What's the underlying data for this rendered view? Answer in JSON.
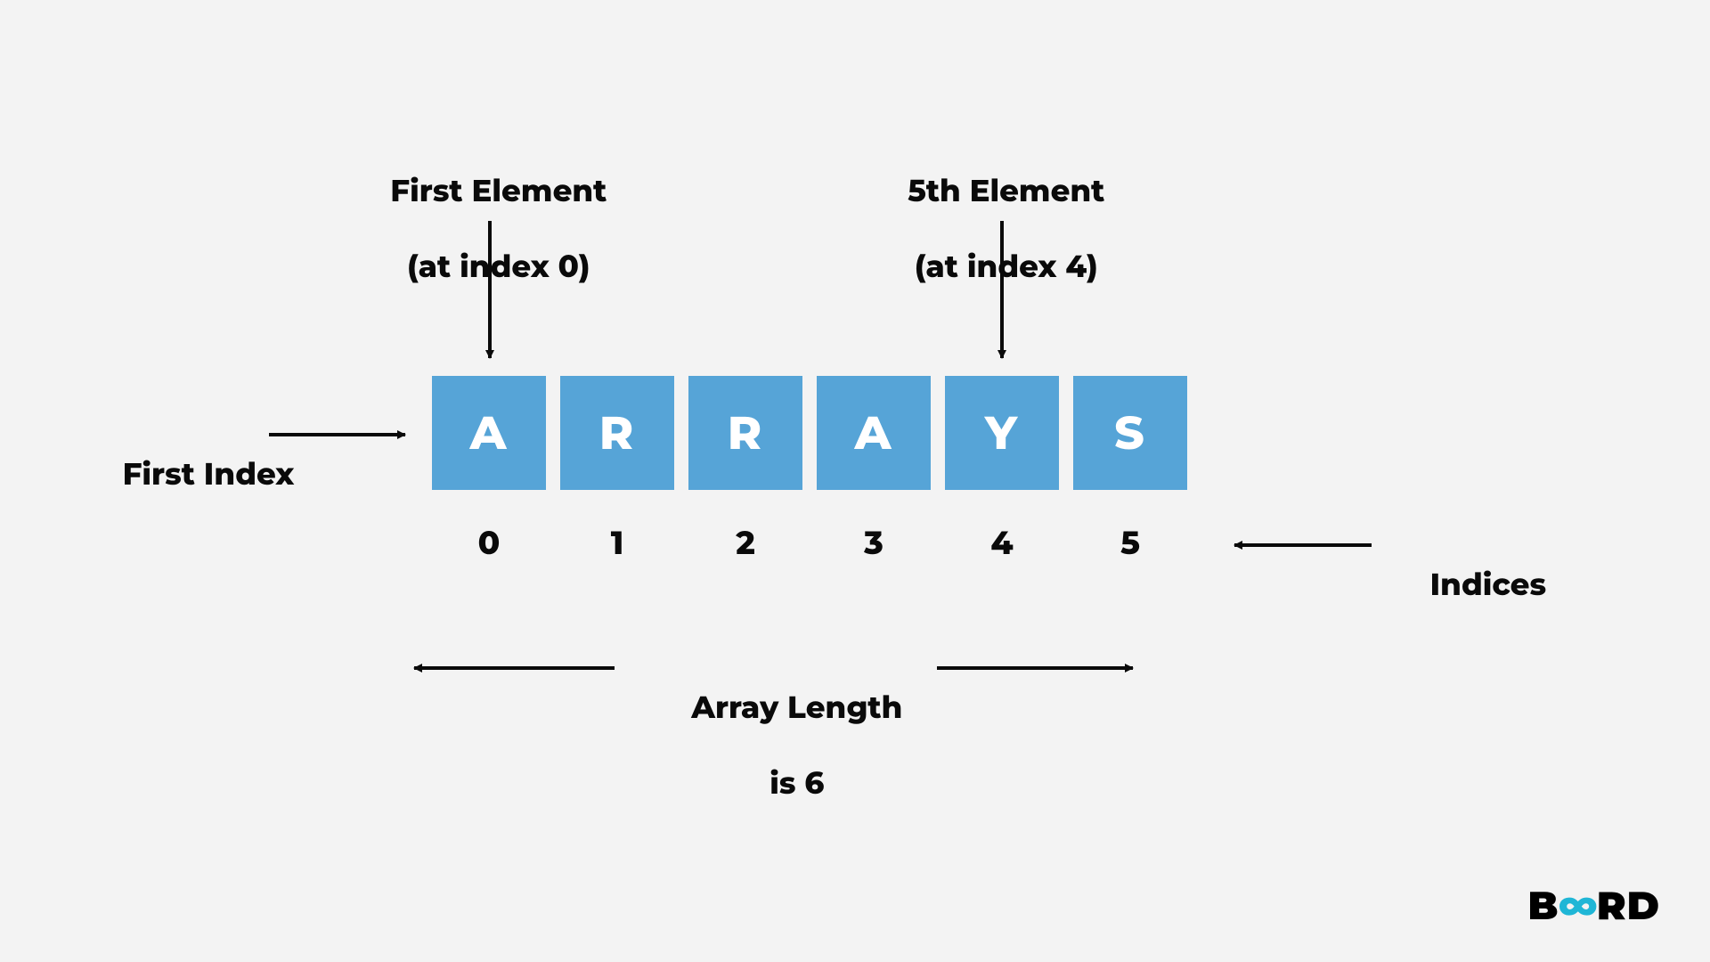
{
  "labels": {
    "first_element_line1": "First Element",
    "first_element_line2": "(at index 0)",
    "fifth_element_line1": "5th Element",
    "fifth_element_line2": "(at index 4)",
    "first_index": "First Index",
    "indices": "Indices",
    "array_length_line1": "Array Length",
    "array_length_line2": "is 6"
  },
  "cells": [
    "A",
    "R",
    "R",
    "A",
    "Y",
    "S"
  ],
  "indices": [
    "0",
    "1",
    "2",
    "3",
    "4",
    "5"
  ],
  "brand": {
    "left": "B",
    "mid": "∞",
    "right": "RD"
  },
  "colors": {
    "cell_bg": "#56a4d7",
    "cell_fg": "#ffffff",
    "page_bg": "#f3f3f3",
    "text": "#0a0a0a",
    "brand_accent": "#1fb6d6"
  }
}
